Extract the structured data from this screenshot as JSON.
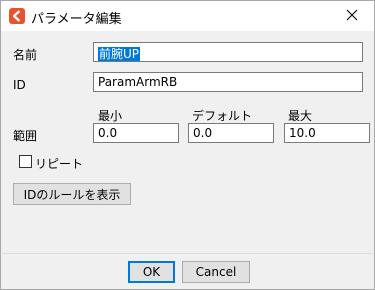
{
  "window": {
    "title": "パラメータ編集",
    "close_glyph": "✕"
  },
  "fields": {
    "name_label": "名前",
    "name_value": "前腕UP",
    "id_label": "ID",
    "id_value": "ParamArmRB",
    "range_label": "範囲",
    "min_label": "最小",
    "min_value": "0.0",
    "default_label": "デフォルト",
    "default_value": "0.0",
    "max_label": "最大",
    "max_value": "10.0"
  },
  "options": {
    "repeat_label": "リピート",
    "repeat_checked": false
  },
  "buttons": {
    "id_rules_label": "IDのルールを表示",
    "ok_label": "OK",
    "cancel_label": "Cancel"
  },
  "icons": {
    "app": "app-logo-icon",
    "close": "close-icon"
  },
  "colors": {
    "accent": "#0078d7",
    "app_icon": "#e8532b"
  }
}
